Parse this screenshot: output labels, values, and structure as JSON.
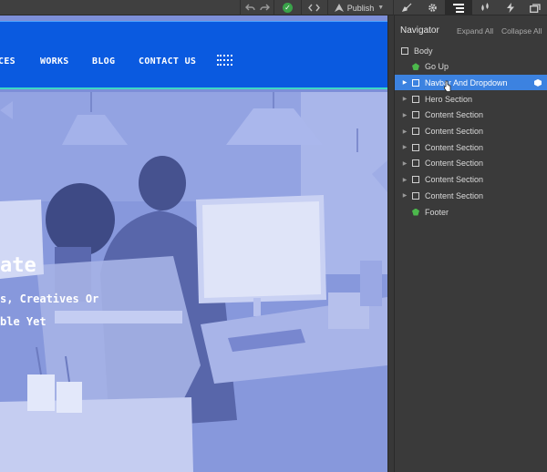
{
  "toolbar": {
    "undo_icon": "undo-icon",
    "redo_icon": "redo-icon",
    "status_icon": "check-circle-icon",
    "code_icon": "code-icon",
    "publish_label": "Publish",
    "tabs": [
      "brush-icon",
      "gear-icon",
      "navigator-icon",
      "drops-icon",
      "lightning-icon",
      "assets-icon"
    ],
    "active_tab": "navigator-icon"
  },
  "canvas": {
    "nav_items": [
      "CES",
      "WORKS",
      "BLOG",
      "CONTACT US"
    ],
    "hero_title": "ate",
    "hero_lines": [
      "s, Creatives Or",
      "ble Yet"
    ],
    "colors": {
      "navbar": "#0a5ae0",
      "hero_tint": "#8a9ce0",
      "accent_line": "#3dd9c5"
    }
  },
  "navigator": {
    "title": "Navigator",
    "expand_all": "Expand All",
    "collapse_all": "Collapse All",
    "tree": [
      {
        "label": "Body",
        "icon": "box",
        "caret": false,
        "indent": 0
      },
      {
        "label": "Go Up",
        "icon": "symbol",
        "caret": false,
        "indent": 1
      },
      {
        "label": "Navbar And Dropdown",
        "icon": "box",
        "caret": true,
        "indent": 1,
        "selected": true
      },
      {
        "label": "Hero Section",
        "icon": "box",
        "caret": true,
        "indent": 1
      },
      {
        "label": "Content Section",
        "icon": "box",
        "caret": true,
        "indent": 1
      },
      {
        "label": "Content Section",
        "icon": "box",
        "caret": true,
        "indent": 1
      },
      {
        "label": "Content Section",
        "icon": "box",
        "caret": true,
        "indent": 1
      },
      {
        "label": "Content Section",
        "icon": "box",
        "caret": true,
        "indent": 1
      },
      {
        "label": "Content Section",
        "icon": "box",
        "caret": true,
        "indent": 1
      },
      {
        "label": "Content Section",
        "icon": "box",
        "caret": true,
        "indent": 1
      },
      {
        "label": "Footer",
        "icon": "symbol",
        "caret": false,
        "indent": 1
      }
    ],
    "selected_color": "#3c82e0"
  }
}
